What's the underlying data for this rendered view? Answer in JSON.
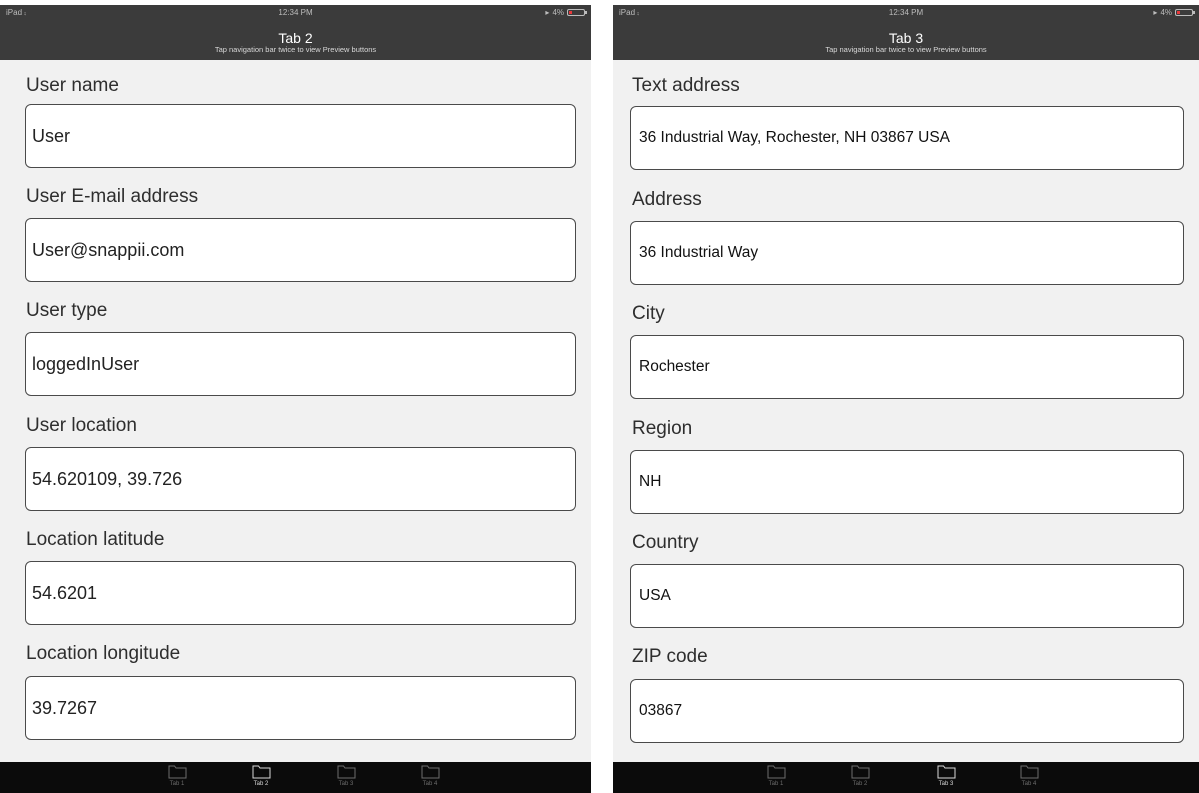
{
  "screens": [
    {
      "status": {
        "carrier": "iPad ",
        "time": "12:34 PM",
        "battery": "4%"
      },
      "nav": {
        "title": "Tab 2",
        "subtitle": "Tap navigation bar twice to view Preview buttons"
      },
      "fields": [
        {
          "label": "User name",
          "value": "User"
        },
        {
          "label": "User E-mail address",
          "value": "User@snappii.com"
        },
        {
          "label": "User type",
          "value": "loggedInUser"
        },
        {
          "label": "User location",
          "value": "54.620109, 39.726"
        },
        {
          "label": "Location latitude",
          "value": "54.6201"
        },
        {
          "label": "Location longitude",
          "value": "39.7267"
        }
      ],
      "tabs": [
        {
          "label": "Tab 1",
          "icon": "folder-icon",
          "active": false
        },
        {
          "label": "Tab 2",
          "icon": "folder-icon",
          "active": true
        },
        {
          "label": "Tab 3",
          "icon": "folder-icon",
          "active": false
        },
        {
          "label": "Tab 4",
          "icon": "folder-icon",
          "active": false
        }
      ]
    },
    {
      "status": {
        "carrier": "iPad ",
        "time": "12:34 PM",
        "battery": "4%"
      },
      "nav": {
        "title": "Tab 3",
        "subtitle": "Tap navigation bar twice to view Preview buttons"
      },
      "fields": [
        {
          "label": "Text address",
          "value": "36 Industrial Way, Rochester, NH 03867 USA"
        },
        {
          "label": "Address",
          "value": "36 Industrial Way"
        },
        {
          "label": "City",
          "value": "Rochester"
        },
        {
          "label": "Region",
          "value": "NH"
        },
        {
          "label": "Country",
          "value": "USA"
        },
        {
          "label": "ZIP code",
          "value": "03867"
        }
      ],
      "tabs": [
        {
          "label": "Tab 1",
          "icon": "folder-icon",
          "active": false
        },
        {
          "label": "Tab 2",
          "icon": "folder-icon",
          "active": false
        },
        {
          "label": "Tab 3",
          "icon": "folder-icon",
          "active": true
        },
        {
          "label": "Tab 4",
          "icon": "folder-icon",
          "active": false
        }
      ]
    }
  ],
  "colors": {
    "navbar": "#3b3b3b",
    "background": "#f1f1f1",
    "tabbar": "#0b0b0b",
    "field_border": "#4a4a4a",
    "battery_low": "#e8383b"
  }
}
